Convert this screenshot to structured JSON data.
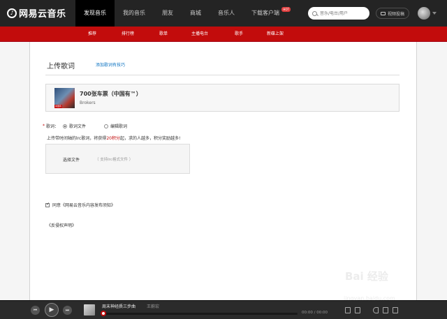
{
  "header": {
    "logo_text": "网易云音乐",
    "nav": [
      "发现音乐",
      "我的音乐",
      "朋友",
      "商城",
      "音乐人",
      "下载客户端"
    ],
    "hot_badge": "HOT",
    "search_placeholder": "音乐/电台/用户",
    "video_label": "视频投稿"
  },
  "subnav": [
    "推荐",
    "排行榜",
    "歌单",
    "主播电台",
    "歌手",
    "新碟上架"
  ],
  "page": {
    "title": "上传歌词",
    "tip_link": "添加歌词有技巧"
  },
  "song": {
    "name": "700张车票（中国有™）",
    "artist": "Brokers",
    "cover_badge": "中国有"
  },
  "lyrics": {
    "required_mark": "*",
    "label": "歌词：",
    "options": [
      "歌词文件",
      "编辑歌词"
    ],
    "hint_before": "上传带时间轴的lrc歌词，将获得",
    "hint_points": "20积分",
    "hint_after": "起，求的人越多，积分奖励越多!",
    "choose_file": "选择文件",
    "format_hint": "（ 支持lrc格式文件 ）"
  },
  "agreement": {
    "label": "同意《网易云音乐内容发布须知》",
    "checked": true,
    "rights_link": "《反侵权声明》"
  },
  "player": {
    "track": "周末神经质三步曲",
    "artist": "王蔚宏",
    "time": "00:00 / 00:00",
    "progress": 0
  },
  "colors": {
    "brand_red": "#c20c0c",
    "topbar": "#242424",
    "link_blue": "#0c73c2"
  }
}
